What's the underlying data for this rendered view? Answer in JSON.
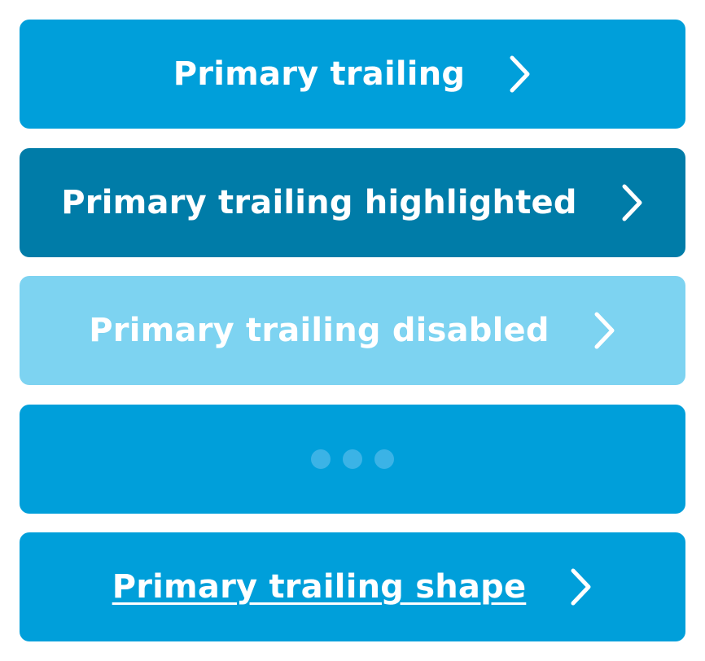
{
  "colors": {
    "primary": "#009fda",
    "highlighted": "#007ca8",
    "disabled": "#7dd3f1",
    "label": "#ffffff",
    "loading_dot": "#3bb3e6"
  },
  "buttons": [
    {
      "label": "Primary trailing",
      "state": "normal",
      "trailing_icon": "chevron-right-icon"
    },
    {
      "label": "Primary trailing highlighted",
      "state": "highlighted",
      "trailing_icon": "chevron-right-icon"
    },
    {
      "label": "Primary trailing disabled",
      "state": "disabled",
      "trailing_icon": "chevron-right-icon"
    },
    {
      "label": "",
      "state": "loading",
      "trailing_icon": "loading-dots-icon"
    },
    {
      "label": "Primary trailing shape",
      "state": "shape",
      "trailing_icon": "chevron-right-icon"
    }
  ]
}
